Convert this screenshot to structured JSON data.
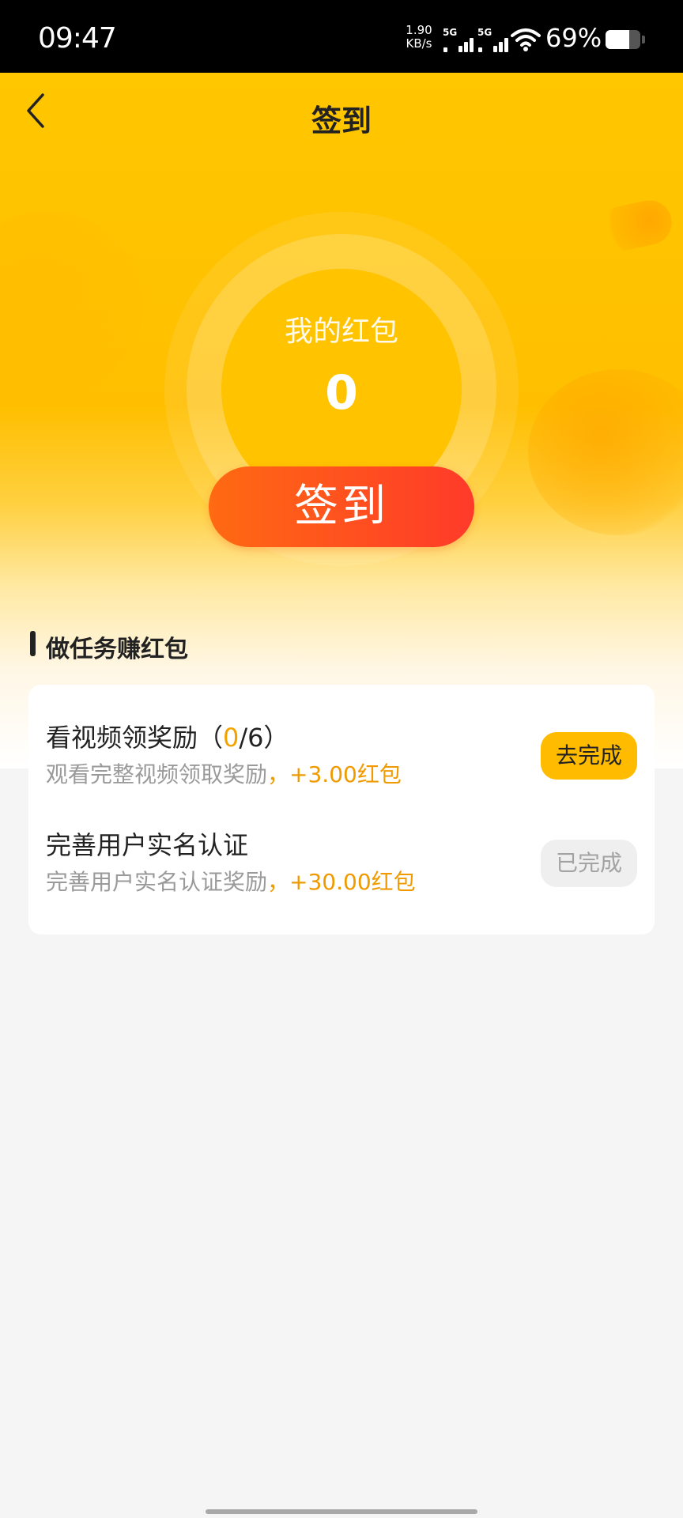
{
  "status_bar": {
    "time": "09:47",
    "net_speed_value": "1.90",
    "net_speed_unit": "KB/s",
    "signal_1_label": "5G",
    "signal_2_label": "5G",
    "battery_percent": "69%",
    "battery_level": 0.69
  },
  "nav": {
    "back_icon": "chevron-left-icon",
    "title": "签到"
  },
  "wallet": {
    "label": "我的红包",
    "amount": "0"
  },
  "signin_button": {
    "label": "签到"
  },
  "tasks_section": {
    "title": "做任务赚红包",
    "items": [
      {
        "title_prefix": "看视频领奖励（",
        "progress_current": "0",
        "progress_suffix": "/6）",
        "desc": "观看完整视频领取奖励",
        "reward": "，+3.00红包",
        "button_label": "去完成",
        "button_state": "pending"
      },
      {
        "title_prefix": "完善用户实名认证",
        "desc": "完善用户实名认证奖励",
        "reward": "，+30.00红包",
        "button_label": "已完成",
        "button_state": "completed"
      }
    ]
  },
  "colors": {
    "header_yellow": "#ffc700",
    "accent_orange": "#ff5a1a",
    "reward_orange": "#f09a00",
    "button_yellow": "#ffbb00"
  }
}
